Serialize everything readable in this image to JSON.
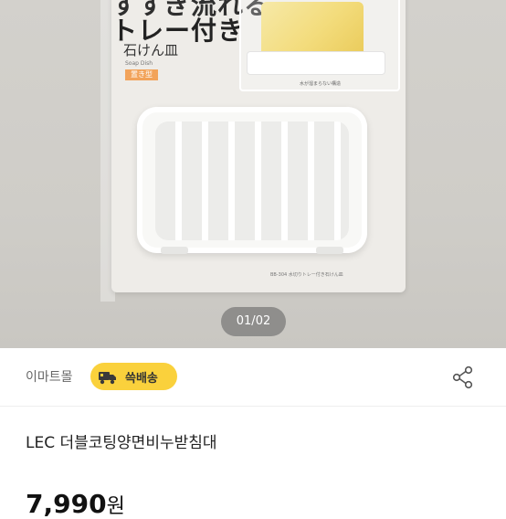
{
  "gallery": {
    "counter": "01/02",
    "packaging": {
      "line1": "すすぎ流れる",
      "line2": "トレー付き",
      "line3": "石けん皿",
      "english": "Soap Dish",
      "tag": "置き型",
      "inset_caption": "水が溜まらない構造",
      "footer_code": "BB-304 水切りトレー付き石けん皿"
    }
  },
  "seller": {
    "name": "이마트몰",
    "delivery_badge": "쓱배송",
    "badge_color": "#fad13c",
    "share_icon": "share-icon",
    "truck_icon": "truck-icon"
  },
  "product": {
    "title": "LEC 더블코팅양면비누받침대",
    "price": "7,990",
    "price_unit": "원"
  }
}
